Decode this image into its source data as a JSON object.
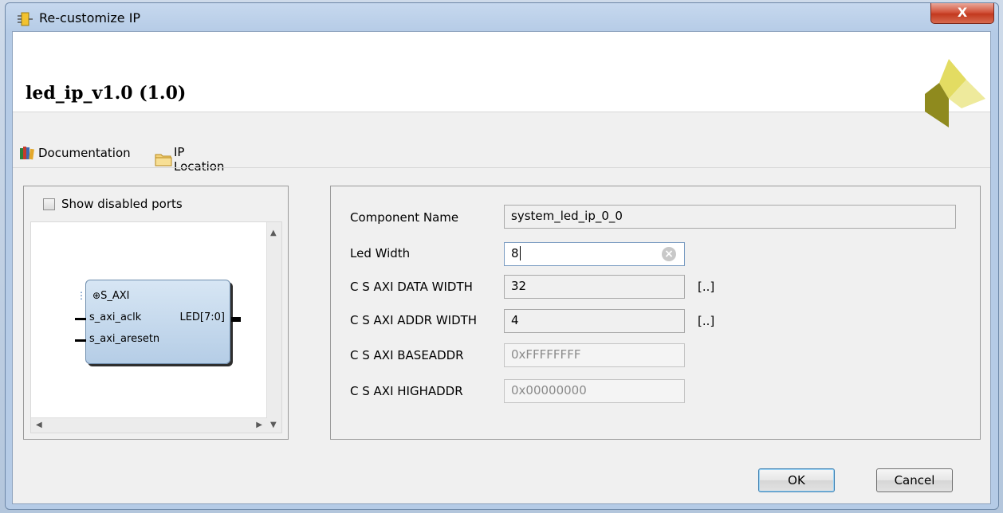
{
  "window": {
    "title": "Re-customize IP",
    "close_glyph": "X"
  },
  "header": {
    "ip_title": "led_ip_v1.0 (1.0)",
    "logo": "xilinx-logo"
  },
  "toolbar": {
    "documentation_label": "Documentation",
    "ip_location_label": "IP Location"
  },
  "left_panel": {
    "show_disabled_ports_label": "Show disabled ports",
    "show_disabled_ports_checked": false,
    "block": {
      "bus_port": "S_AXI",
      "ports_left": [
        "s_axi_aclk",
        "s_axi_aresetn"
      ],
      "port_right": "LED[7:0]"
    }
  },
  "form": {
    "component_name": {
      "label": "Component Name",
      "value": "system_led_ip_0_0"
    },
    "led_width": {
      "label": "Led Width",
      "value": "8"
    },
    "data_width": {
      "label": "C S AXI DATA WIDTH",
      "value": "32",
      "range_button": "[..]"
    },
    "addr_width": {
      "label": "C S AXI ADDR WIDTH",
      "value": "4",
      "range_button": "[..]"
    },
    "baseaddr": {
      "label": "C S AXI BASEADDR",
      "value": "0xFFFFFFFF"
    },
    "highaddr": {
      "label": "C S AXI HIGHADDR",
      "value": "0x00000000"
    }
  },
  "buttons": {
    "ok": "OK",
    "cancel": "Cancel"
  },
  "colors": {
    "window_frame": "#b5cbe6",
    "close_button": "#c2391f",
    "logo_yellow": "#d8d04a",
    "logo_olive": "#8f8a1e"
  }
}
